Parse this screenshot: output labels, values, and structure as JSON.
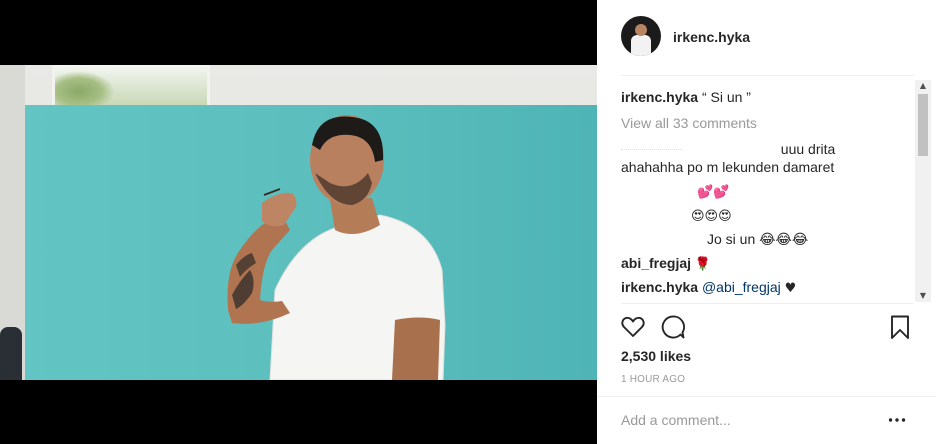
{
  "post": {
    "username": "irkenc.hyka",
    "caption": "“ Si un ”",
    "view_all_comments": "View all 33 comments",
    "likes": "2,530 likes",
    "time": "1 HOUR AGO",
    "add_comment_placeholder": "Add a comment..."
  },
  "comments": [
    {
      "username": "",
      "text": "uuu drita"
    },
    {
      "username": "",
      "text": "ahahahha po m lekunden damaret"
    },
    {
      "username": "",
      "text": "💕💕"
    },
    {
      "username": "",
      "text": "😍😍😍"
    },
    {
      "username": "",
      "text": "Jo si un 😂😂😂"
    },
    {
      "username": "abi_fregjaj",
      "text": "🌹"
    },
    {
      "username": "irkenc.hyka",
      "mention": "@abi_fregjaj",
      "text": "♥"
    }
  ],
  "icons": [
    "heart-icon",
    "comment-icon",
    "bookmark-icon",
    "more-options-icon",
    "scroll-up-icon",
    "scroll-down-icon"
  ],
  "colors": {
    "link": "#003569",
    "muted": "#999999",
    "divider": "#efefef",
    "backdrop": "#5bc0bf"
  }
}
